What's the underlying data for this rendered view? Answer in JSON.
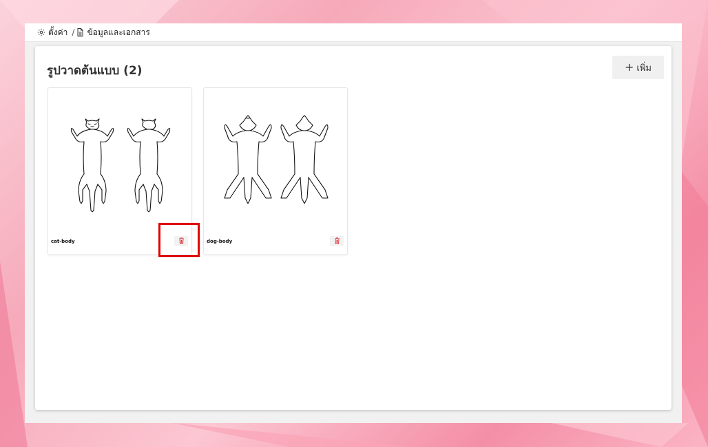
{
  "breadcrumb": {
    "settings_label": "ตั้งค่า",
    "separator": "/",
    "page_label": "ข้อมูลและเอกสาร",
    "settings_icon": "gear-icon",
    "page_icon": "document-icon"
  },
  "panel": {
    "title": "รูปวาดต้นแบบ (2)",
    "add_button_label": "เพิ่ม",
    "add_icon": "plus-icon"
  },
  "templates": [
    {
      "name": "cat-body",
      "image": "cat-body-outline"
    },
    {
      "name": "dog-body",
      "image": "dog-body-outline"
    }
  ],
  "colors": {
    "delete_icon": "#e0474c",
    "highlight": "#e00000"
  }
}
